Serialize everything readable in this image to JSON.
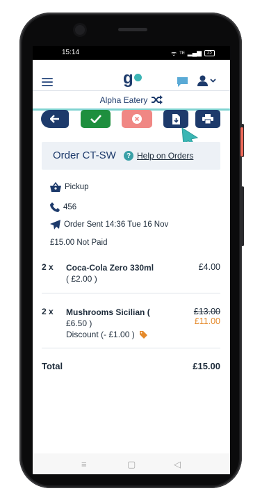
{
  "status_bar": {
    "time": "15:14",
    "signal": "ᯤ",
    "net": "ᵀᴱ",
    "bars": "▂▄▆",
    "battery": "25"
  },
  "header": {
    "logo_letter": "g"
  },
  "venue": {
    "name": "Alpha Eatery"
  },
  "actions": [
    "back",
    "accept",
    "reject",
    "download",
    "print"
  ],
  "order": {
    "title": "Order CT-SW",
    "help_label": "Help on Orders"
  },
  "details": {
    "fulfilment": "Pickup",
    "phone": "456",
    "sent": "Order Sent 14:36 Tue 16 Nov",
    "payment": "£15.00 Not Paid"
  },
  "items": [
    {
      "qty": "2 x",
      "name": "Coca-Cola Zero 330ml",
      "unit": "( £2.00 )",
      "price": "£4.00"
    },
    {
      "qty": "2 x",
      "name": "Mushrooms Sicilian (",
      "unit": "£6.50 )",
      "discount": "Discount (- £1.00 )",
      "old_price": "£13.00",
      "new_price": "£11.00"
    }
  ],
  "total": {
    "label": "Total",
    "value": "£15.00"
  },
  "colors": {
    "navy": "#1d3a6b",
    "green": "#1e8f3e",
    "salmon": "#f08784",
    "teal": "#3db5b5",
    "orange": "#e58a2b"
  },
  "nav": {
    "recents": "≡",
    "home": "▢",
    "back": "◁"
  }
}
